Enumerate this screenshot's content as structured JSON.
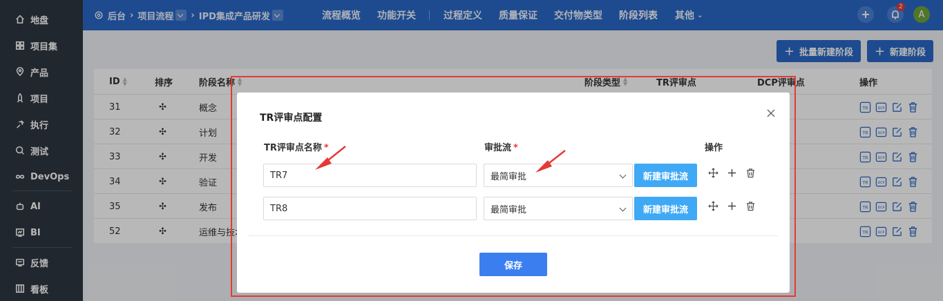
{
  "sidebar": {
    "items": [
      {
        "label": "地盘",
        "icon": "home-icon"
      },
      {
        "label": "项目集",
        "icon": "grid-icon"
      },
      {
        "label": "产品",
        "icon": "location-pin-icon"
      },
      {
        "label": "项目",
        "icon": "rocket-icon"
      },
      {
        "label": "执行",
        "icon": "run-icon"
      },
      {
        "label": "测试",
        "icon": "search-bug-icon"
      },
      {
        "label": "DevOps",
        "icon": "infinity-icon"
      },
      {
        "label": "AI",
        "icon": "robot-icon"
      },
      {
        "label": "BI",
        "icon": "chart-board-icon"
      },
      {
        "label": "反馈",
        "icon": "feedback-icon"
      },
      {
        "label": "看板",
        "icon": "kanban-icon"
      }
    ]
  },
  "topbar": {
    "breadcrumb": [
      "后台",
      "项目流程",
      "IPD集成产品研发"
    ],
    "nav": [
      "流程概览",
      "功能开关",
      "过程定义",
      "质量保证",
      "交付物类型",
      "阶段列表",
      "其他"
    ],
    "active_nav": "阶段列表",
    "notification_count": "2",
    "avatar_letter": "A"
  },
  "actions": {
    "batch_new": "批量新建阶段",
    "new": "新建阶段"
  },
  "table": {
    "headers": {
      "id": "ID",
      "order": "排序",
      "name": "阶段名称",
      "type": "阶段类型",
      "tr": "TR评审点",
      "dcp": "DCP评审点",
      "ops": "操作"
    },
    "rows": [
      {
        "id": "31",
        "name": "概念"
      },
      {
        "id": "32",
        "name": "计划"
      },
      {
        "id": "33",
        "name": "开发"
      },
      {
        "id": "34",
        "name": "验证"
      },
      {
        "id": "35",
        "name": "发布"
      },
      {
        "id": "52",
        "name": "运维与技术"
      }
    ]
  },
  "modal": {
    "title": "TR评审点配置",
    "col_name": "TR评审点名称",
    "col_flow": "审批流",
    "col_ops": "操作",
    "rows": [
      {
        "name": "TR7",
        "flow": "最简审批",
        "new_flow": "新建审批流"
      },
      {
        "name": "TR8",
        "flow": "最简审批",
        "new_flow": "新建审批流"
      }
    ],
    "save": "保存"
  },
  "colors": {
    "topbar": "#2a68c7",
    "sidebar": "#2f3640",
    "primary": "#3a7ef0",
    "light_button": "#3fa9f5",
    "annotation": "#e53935"
  }
}
